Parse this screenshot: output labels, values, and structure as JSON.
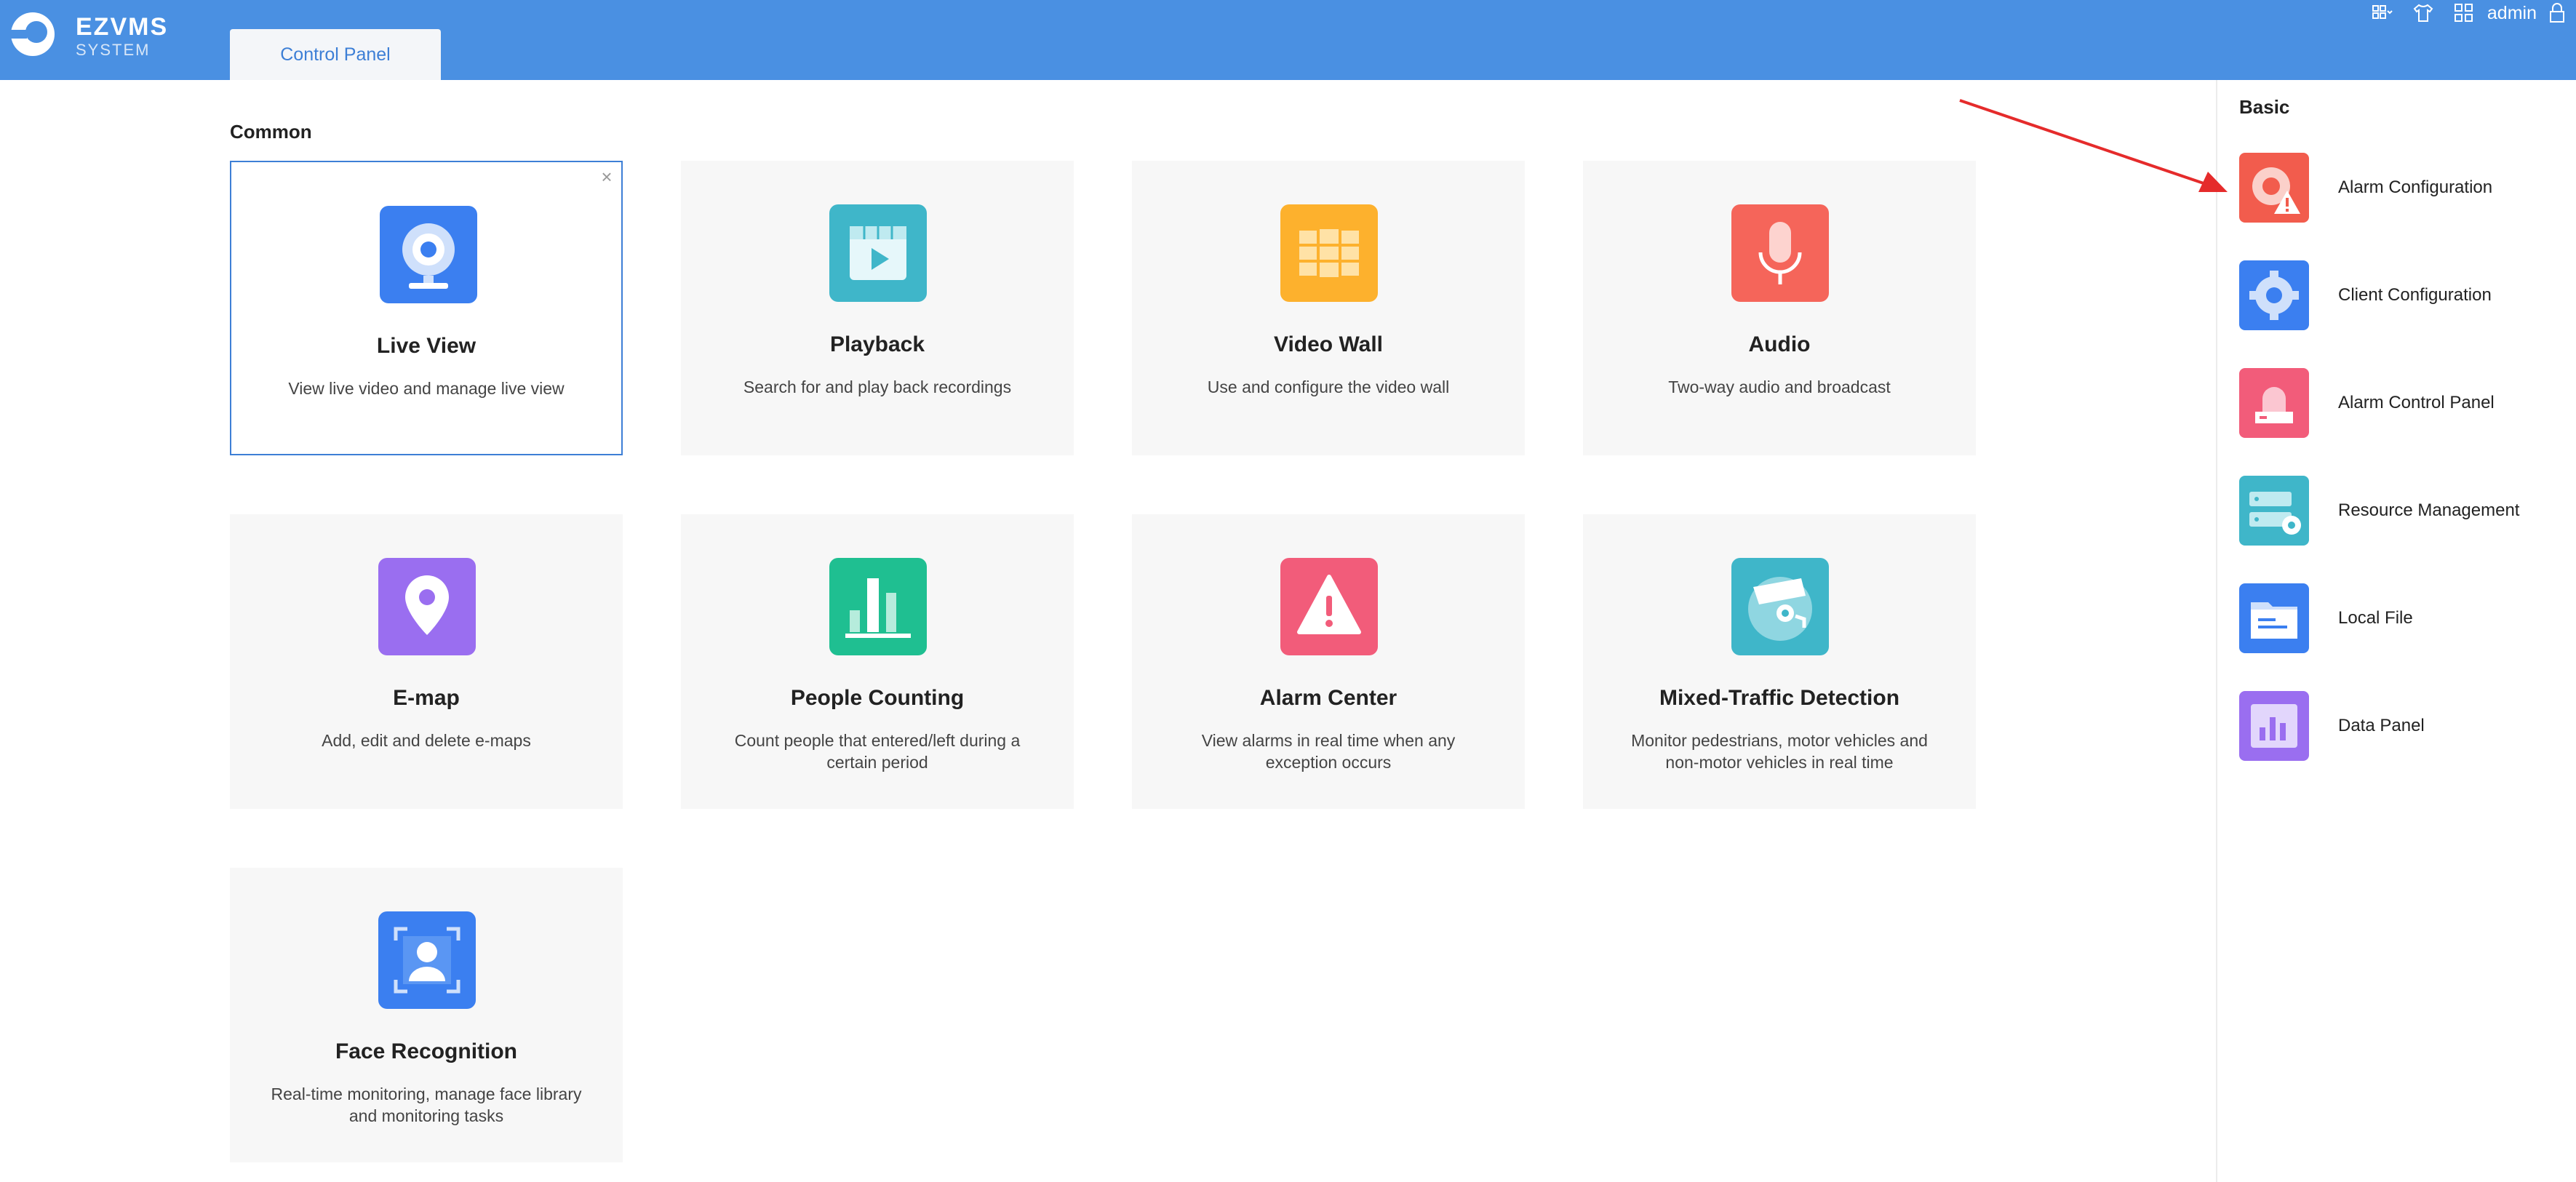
{
  "header": {
    "brand_name": "EZVMS",
    "brand_sub": "SYSTEM",
    "tab_label": "Control Panel",
    "user": "admin",
    "icons": [
      "grid-menu-icon",
      "shirt-icon",
      "layout-icon",
      "lock-icon"
    ],
    "color": "#4a90e2"
  },
  "main": {
    "section_title": "Common",
    "cards": [
      {
        "title": "Live View",
        "desc": "View live video and manage live view",
        "icon": "camera-icon",
        "color": "#3b7ff0",
        "selected": true
      },
      {
        "title": "Playback",
        "desc": "Search for and play back recordings",
        "icon": "playback-icon",
        "color": "#3fb6c9"
      },
      {
        "title": "Video Wall",
        "desc": "Use and configure the video wall",
        "icon": "video-wall-icon",
        "color": "#fdb12d"
      },
      {
        "title": "Audio",
        "desc": "Two-way audio and broadcast",
        "icon": "microphone-icon",
        "color": "#f5655a"
      },
      {
        "title": "E-map",
        "desc": "Add, edit and delete e-maps",
        "icon": "map-pin-icon",
        "color": "#9a6ef0"
      },
      {
        "title": "People Counting",
        "desc": "Count people that entered/left during a certain period",
        "icon": "bar-chart-icon",
        "color": "#1fbf91"
      },
      {
        "title": "Alarm Center",
        "desc": "View alarms in real time when any exception occurs",
        "icon": "warning-icon",
        "color": "#f25c7a"
      },
      {
        "title": "Mixed-Traffic Detection",
        "desc": "Monitor pedestrians, motor vehicles and non-motor vehicles in real time",
        "icon": "traffic-camera-icon",
        "color": "#3fb6c9"
      },
      {
        "title": "Face Recognition",
        "desc": "Real-time monitoring, manage face library and monitoring tasks",
        "icon": "face-icon",
        "color": "#3b7ff0"
      }
    ]
  },
  "right_panel": {
    "title": "Basic",
    "items": [
      {
        "label": "Alarm Configuration",
        "icon": "alarm-config-icon",
        "color": "#f25c4d"
      },
      {
        "label": "Client Configuration",
        "icon": "gear-icon",
        "color": "#3b7ff0"
      },
      {
        "label": "Alarm Control Panel",
        "icon": "alarm-panel-icon",
        "color": "#f25c7a"
      },
      {
        "label": "Resource Management",
        "icon": "resource-icon",
        "color": "#3fb6c9"
      },
      {
        "label": "Local File",
        "icon": "folder-icon",
        "color": "#3b7ff0"
      },
      {
        "label": "Data Panel",
        "icon": "data-panel-icon",
        "color": "#9a6ef0"
      }
    ]
  }
}
